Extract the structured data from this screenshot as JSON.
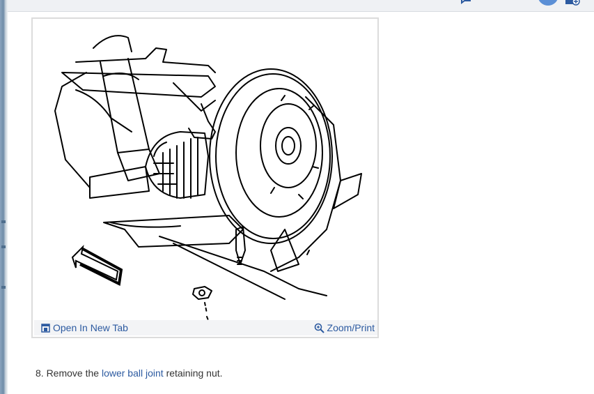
{
  "figure": {
    "open_tab_label": "Open In New Tab",
    "zoom_print_label": "Zoom/Print"
  },
  "step": {
    "number_prefix": "8. Remove the",
    "link_text": "lower ball joint",
    "suffix": "retaining nut."
  },
  "icons": {
    "open_tab": "open-in-new-tab-icon",
    "zoom": "zoom-in-icon"
  },
  "colors": {
    "link": "#2c5aa0",
    "footer_bg": "#f3f4f6",
    "card_border": "#dcdcdc",
    "avatar": "#5b8fd6"
  }
}
